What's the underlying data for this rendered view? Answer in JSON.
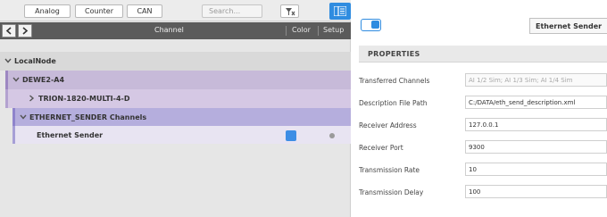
{
  "toolbar": {
    "analog_label": "Analog",
    "counter_label": "Counter",
    "can_label": "CAN",
    "search_placeholder": "Search...",
    "filter_icon": "filter-clear-icon",
    "panel_icon": "panel-toggle-icon"
  },
  "channel_header": {
    "title": "Channel",
    "color_label": "Color",
    "setup_label": "Setup"
  },
  "tree": {
    "local_node": "LocalNode",
    "dewe": "DEWE2-A4",
    "trion": "TRION-1820-MULTI-4-D",
    "ethernet_group": "ETHERNET_SENDER Channels",
    "ethernet_sender": "Ethernet Sender"
  },
  "colors": {
    "accent": "#2f8ce0",
    "channel_color": "#3d8ee5",
    "dewe_row": "#c7bad9",
    "trion_row": "#d5c8e4",
    "ethernet_row": "#b5aedd",
    "sender_row": "#e8e4f2"
  },
  "details": {
    "title": "Ethernet Sender",
    "enabled": true,
    "properties_header": "PROPERTIES",
    "properties": [
      {
        "label": "Transferred Channels",
        "value": "AI 1/2 Sim; AI 1/3 Sim; AI 1/4 Sim"
      },
      {
        "label": "Description File Path",
        "value": "C:/DATA/eth_send_description.xml"
      },
      {
        "label": "Receiver Address",
        "value": "127.0.0.1"
      },
      {
        "label": "Receiver Port",
        "value": "9300"
      },
      {
        "label": "Transmission Rate",
        "value": "10"
      },
      {
        "label": "Transmission Delay",
        "value": "100"
      }
    ]
  }
}
